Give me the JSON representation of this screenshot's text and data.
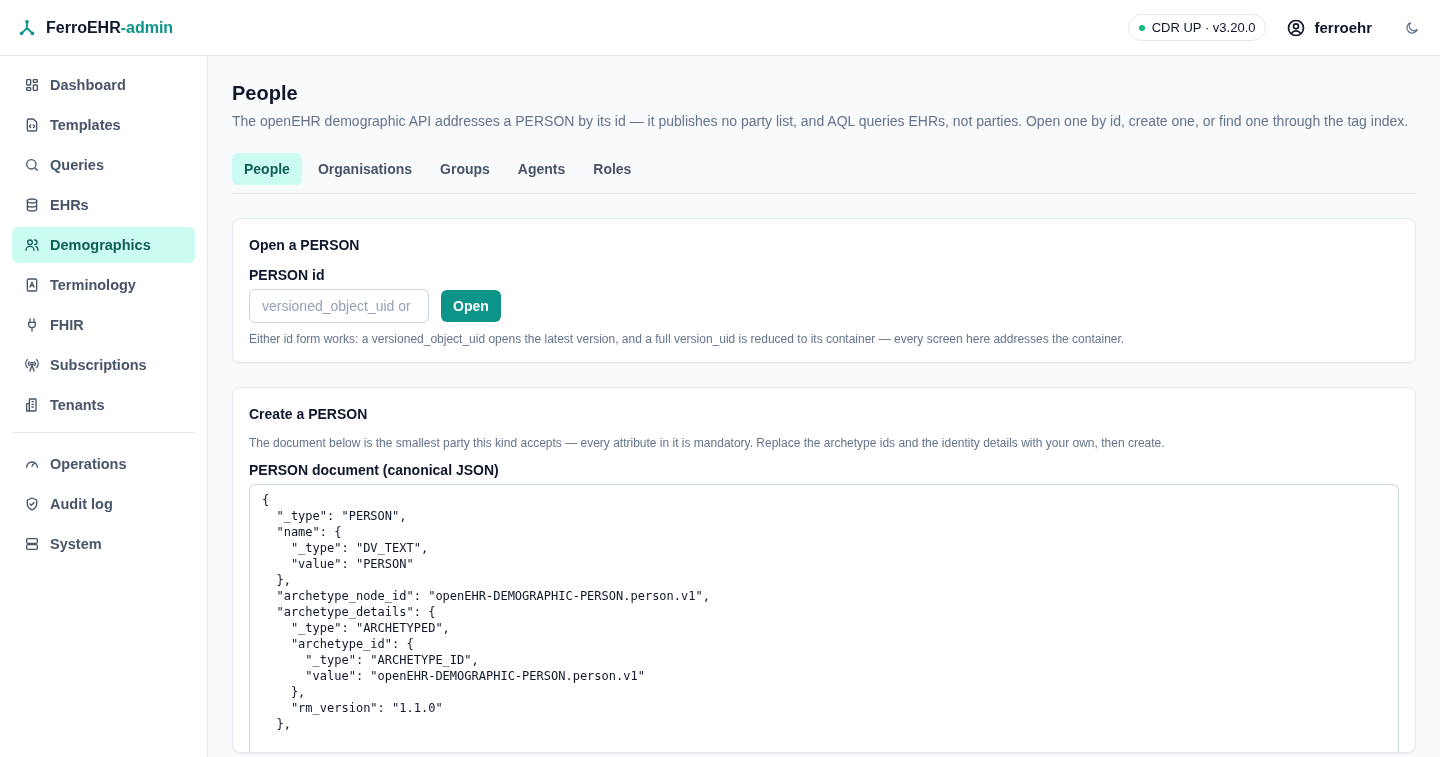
{
  "header": {
    "brand": "FerroEHR",
    "brand_suffix": "-admin",
    "status": {
      "text": "CDR UP · v3.20.0",
      "color": "#10b981"
    },
    "user": "ferroehr"
  },
  "sidebar": {
    "groups": [
      [
        {
          "label": "Dashboard",
          "selected": false
        },
        {
          "label": "Templates",
          "selected": false
        },
        {
          "label": "Queries",
          "selected": false
        },
        {
          "label": "EHRs",
          "selected": false
        },
        {
          "label": "Demographics",
          "selected": true
        },
        {
          "label": "Terminology",
          "selected": false
        },
        {
          "label": "FHIR",
          "selected": false
        },
        {
          "label": "Subscriptions",
          "selected": false
        },
        {
          "label": "Tenants",
          "selected": false
        }
      ],
      [
        {
          "label": "Operations",
          "selected": false
        },
        {
          "label": "Audit log",
          "selected": false
        },
        {
          "label": "System",
          "selected": false
        }
      ]
    ]
  },
  "page": {
    "title": "People",
    "description": "The openEHR demographic API addresses a PERSON by its id — it publishes no party list, and AQL queries EHRs, not parties. Open one by id, create one, or find one through the tag index."
  },
  "tabs": [
    {
      "label": "People",
      "selected": true
    },
    {
      "label": "Organisations",
      "selected": false
    },
    {
      "label": "Groups",
      "selected": false
    },
    {
      "label": "Agents",
      "selected": false
    },
    {
      "label": "Roles",
      "selected": false
    }
  ],
  "open_card": {
    "title": "Open a PERSON",
    "field_label": "PERSON id",
    "placeholder": "versioned_object_uid or",
    "button": "Open",
    "hint": "Either id form works: a versioned_object_uid opens the latest version, and a full version_uid is reduced to its container — every screen here addresses the container."
  },
  "create_card": {
    "title": "Create a PERSON",
    "hint": "The document below is the smallest party this kind accepts — every attribute in it is mandatory. Replace the archetype ids and the identity details with your own, then create.",
    "field_label": "PERSON document (canonical JSON)",
    "value": "{\n  \"_type\": \"PERSON\",\n  \"name\": {\n    \"_type\": \"DV_TEXT\",\n    \"value\": \"PERSON\"\n  },\n  \"archetype_node_id\": \"openEHR-DEMOGRAPHIC-PERSON.person.v1\",\n  \"archetype_details\": {\n    \"_type\": \"ARCHETYPED\",\n    \"archetype_id\": {\n      \"_type\": \"ARCHETYPE_ID\",\n      \"value\": \"openEHR-DEMOGRAPHIC-PERSON.person.v1\"\n    },\n    \"rm_version\": \"1.1.0\"\n  },"
  }
}
